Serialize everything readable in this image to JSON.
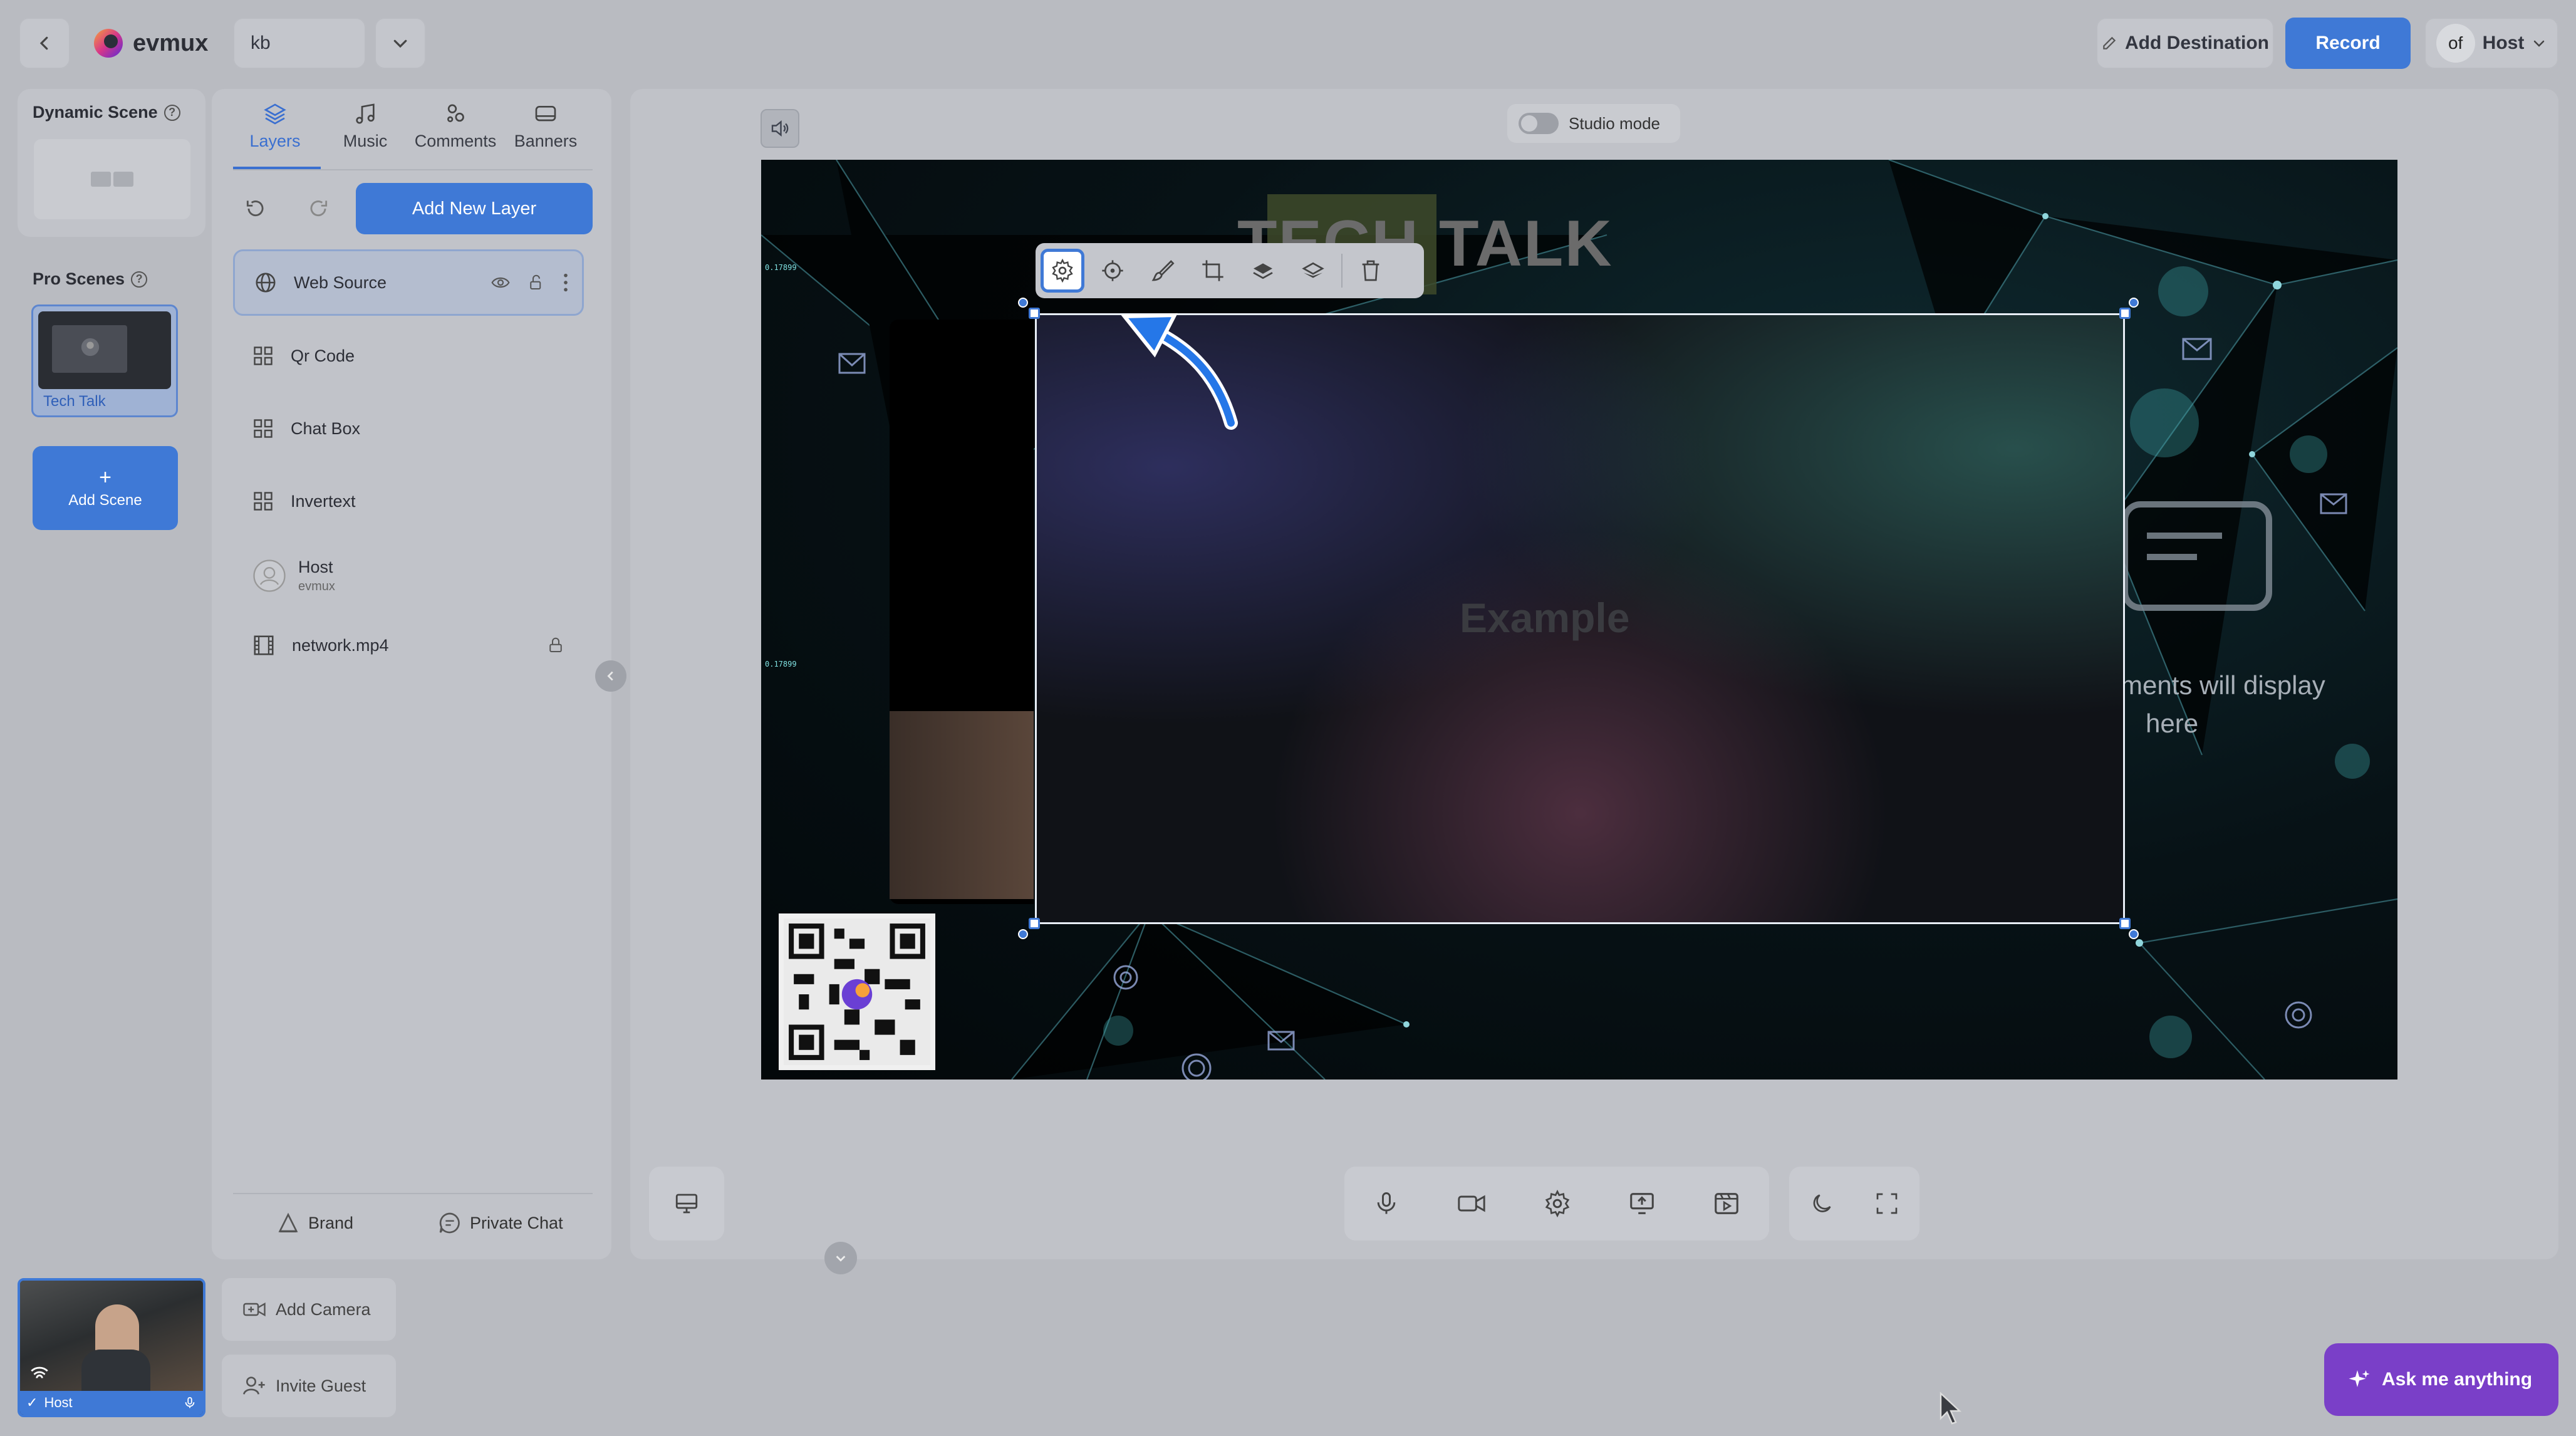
{
  "app": {
    "name": "evmux",
    "scene_selector_value": "kb"
  },
  "header": {
    "add_destination": "Add Destination",
    "record": "Record",
    "user_label": "Host",
    "avatar_text": "of"
  },
  "sidebar": {
    "dynamic_scene_title": "Dynamic Scene",
    "pro_scenes_title": "Pro Scenes",
    "scene_name": "Tech Talk",
    "add_scene_plus": "+",
    "add_scene": "Add Scene"
  },
  "tabs": [
    {
      "label": "Layers",
      "icon": "layers-icon"
    },
    {
      "label": "Music",
      "icon": "music-note-icon"
    },
    {
      "label": "Comments",
      "icon": "comments-icon"
    },
    {
      "label": "Banners",
      "icon": "banner-icon"
    }
  ],
  "layers_panel": {
    "add_new_layer": "Add New Layer",
    "items": [
      {
        "name": "Web Source",
        "icon": "globe-icon"
      },
      {
        "name": "Qr Code",
        "icon": "grid-icon"
      },
      {
        "name": "Chat Box",
        "icon": "grid-icon"
      },
      {
        "name": "Invertext",
        "icon": "grid-icon"
      },
      {
        "name": "Host",
        "sub": "evmux",
        "icon": "avatar-icon"
      },
      {
        "name": "network.mp4",
        "icon": "film-icon"
      }
    ],
    "brand": "Brand",
    "private_chat": "Private Chat"
  },
  "stage": {
    "studio_mode": "Studio mode",
    "title_text": "TECH TALK",
    "overlay_text": "Example",
    "comments_line1": "ments will display",
    "comments_line2": "here",
    "hud_1": "0.17899",
    "hud_2": "0.17899"
  },
  "bottom": {
    "add_camera": "Add Camera",
    "invite_guest": "Invite Guest",
    "camera_host": "Host",
    "ask_me": "Ask me anything"
  }
}
